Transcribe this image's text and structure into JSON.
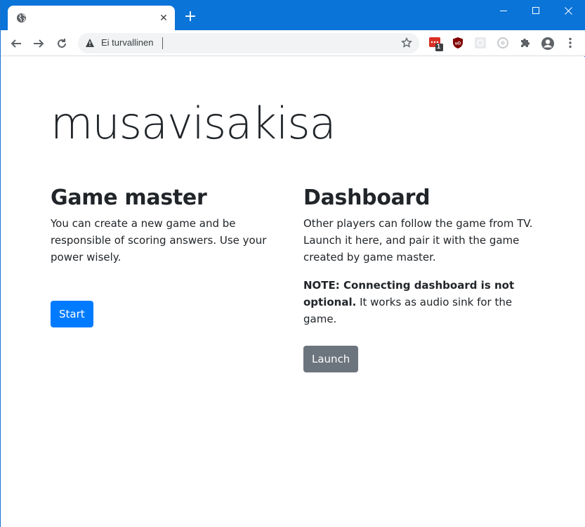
{
  "browser": {
    "tab_title": "",
    "security_label": "Ei turvallinen",
    "address_value": "",
    "extension_badge": "1",
    "accent_color": "#0a74d8"
  },
  "page": {
    "title": "musavisakisa",
    "game_master": {
      "heading": "Game master",
      "description": "You can create a new game and be responsible of scoring answers. Use your power wisely.",
      "button_label": "Start"
    },
    "dashboard": {
      "heading": "Dashboard",
      "description": "Other players can follow the game from TV. Launch it here, and pair it with the game created by game master.",
      "note_bold": "NOTE: Connecting dashboard is not optional.",
      "note_rest": " It works as audio sink for the game.",
      "button_label": "Launch"
    }
  }
}
